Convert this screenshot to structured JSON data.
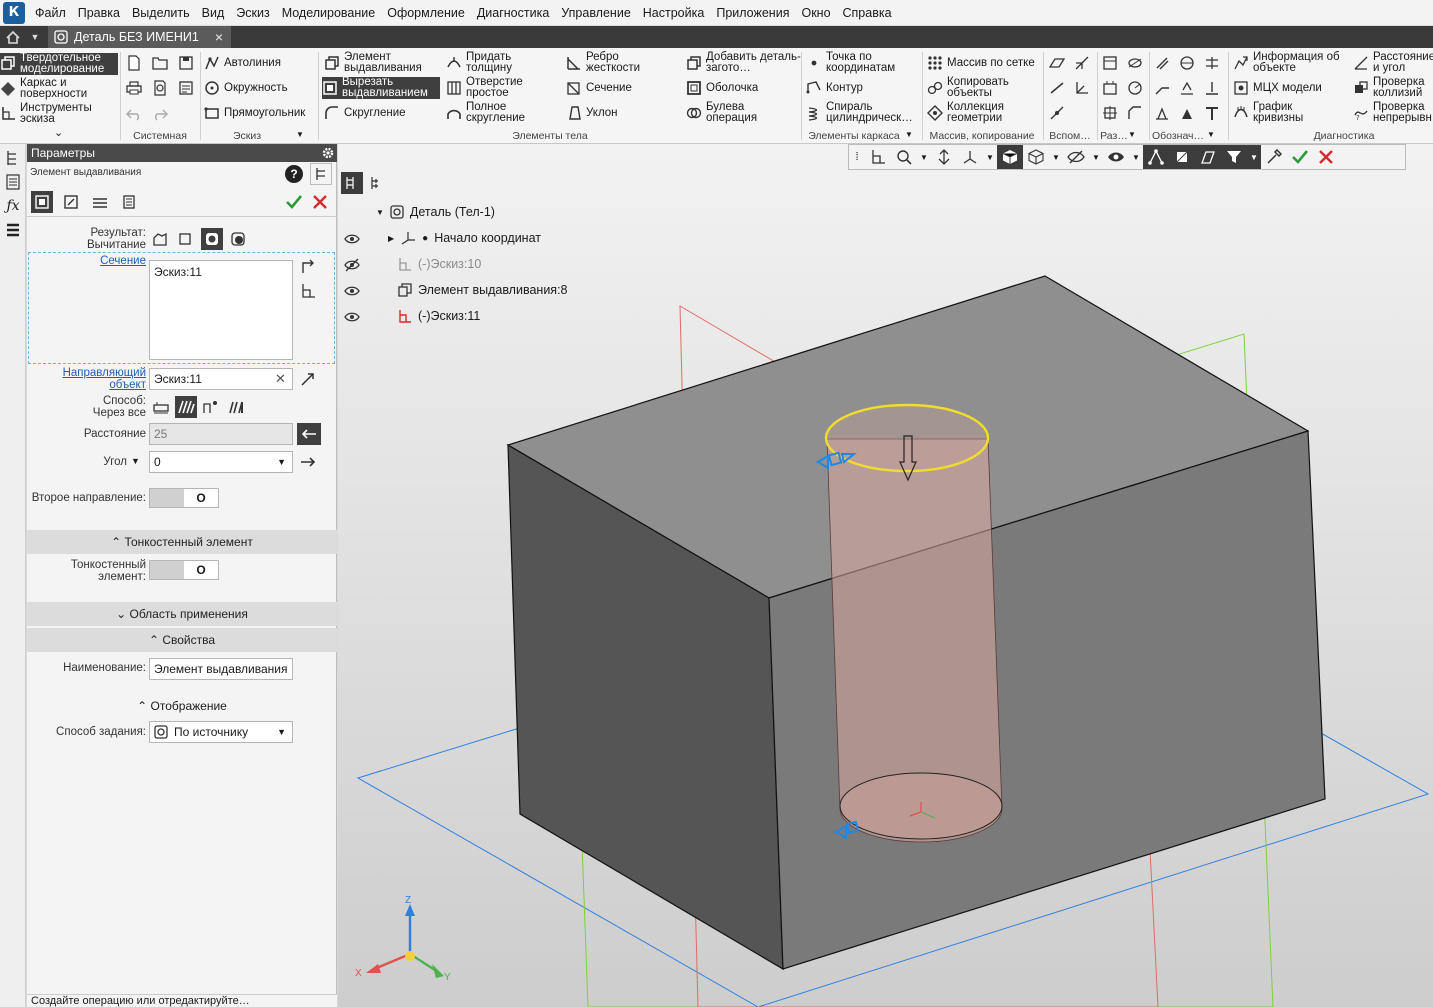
{
  "colors": {
    "accent": "#1c5f9e",
    "ok_green": "#2a9a3a",
    "cancel_red": "#d62b2b",
    "selection_yellow": "#e8d64a",
    "axis_red": "#e0524d",
    "axis_green": "#4fb14f",
    "axis_blue": "#2f7fe0"
  },
  "menu": [
    "Файл",
    "Правка",
    "Выделить",
    "Вид",
    "Эскиз",
    "Моделирование",
    "Оформление",
    "Диагностика",
    "Управление",
    "Настройка",
    "Приложения",
    "Окно",
    "Справка"
  ],
  "app_logo": "К",
  "doc_tab": {
    "title": "Деталь БЕЗ ИМЕНИ1",
    "close": "×"
  },
  "ribbon": {
    "modes": {
      "solid": "Твердотельное моделирование",
      "wireframe": "Каркас и поверхности",
      "sketch_tools": "Инструменты эскиза",
      "more": "⌄"
    },
    "sketch": {
      "autoline": "Автолиния",
      "circle": "Окружность",
      "rect": "Прямоугольник"
    },
    "body": {
      "extrude": "Элемент выдавливания",
      "cut": "Вырезать выдавливанием",
      "fillet": "Скругление",
      "thicken": "Придать толщину",
      "hole": "Отверстие простое",
      "full_fillet": "Полное скругление",
      "rib": "Ребро жесткости",
      "section": "Сечение",
      "draft": "Уклон",
      "add_stock": "Добавить деталь-загото…",
      "shell": "Оболочка",
      "boolean": "Булева операция"
    },
    "frame": {
      "point": "Точка по координатам",
      "contour": "Контур",
      "helix": "Спираль цилиндрическ…"
    },
    "array": {
      "grid": "Массив по сетке",
      "copy": "Копировать объекты",
      "geom": "Коллекция геометрии"
    },
    "diag": {
      "info": "Информация об объекте",
      "mass": "МЦХ модели",
      "curv": "График кривизны",
      "dist": "Расстояние и угол",
      "coll": "Проверка коллизий",
      "cont": "Проверка непрерывн…"
    },
    "groups": {
      "system": "Системная",
      "sketch": "Эскиз",
      "body": "Элементы тела",
      "frame": "Элементы каркаса",
      "array": "Массив, копирование",
      "aux": "Вспом…",
      "sizes": "Раз…",
      "desig": "Обознач…",
      "diag": "Диагностика"
    }
  },
  "panel": {
    "header": "Параметры",
    "subtitle": "Элемент выдавливания",
    "help": "?",
    "result": {
      "label": "Результат:",
      "value": "Вычитание"
    },
    "section": {
      "label": "Сечение",
      "value": "Эскиз:11"
    },
    "direction": {
      "label": "Направляющий объект",
      "value": "Эскиз:11",
      "clear": "✕"
    },
    "method": {
      "label": "Способ:",
      "value": "Через все"
    },
    "distance": {
      "label": "Расстояние",
      "value": "25"
    },
    "angle": {
      "label": "Угол",
      "value": "0",
      "caret": "▼"
    },
    "second_dir": {
      "label": "Второе направление:",
      "knob": "O"
    },
    "thin_section": "Тонкостенный элемент",
    "thin": {
      "label": "Тонкостенный элемент:",
      "knob": "O"
    },
    "scope_section": "Область применения",
    "props_section": "Свойства",
    "name": {
      "label": "Наименование:",
      "value": "Элемент выдавливания"
    },
    "display_section": "Отображение",
    "mode": {
      "label": "Способ задания:",
      "value": "По источнику"
    },
    "status": "Создайте операцию или отредактируйте…"
  },
  "tree": {
    "root": "Деталь (Тел-1)",
    "origin": "Начало координат",
    "sketch10": "(-)Эскиз:10",
    "extrude8": "Элемент выдавливания:8",
    "sketch11": "(-)Эскиз:11"
  },
  "axes": {
    "x": "X",
    "y": "Y",
    "z": "Z"
  }
}
